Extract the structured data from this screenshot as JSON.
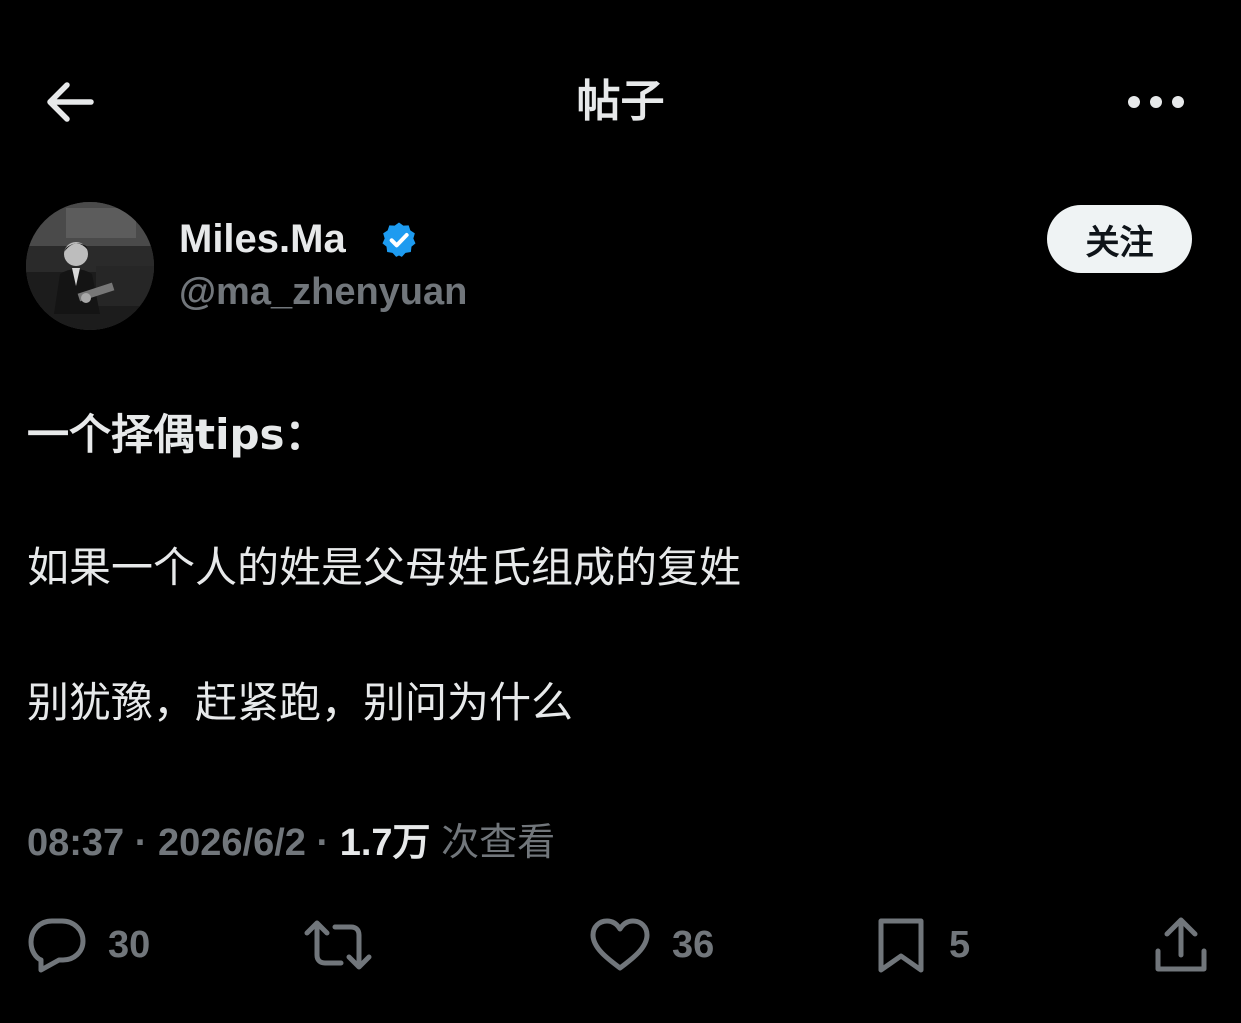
{
  "header": {
    "title": "帖子",
    "back_icon": "arrow-left-icon",
    "more_icon": "more-horizontal-icon"
  },
  "author": {
    "display_name": "Miles.Ma",
    "handle": "@ma_zhenyuan",
    "verified": true,
    "verified_color": "#1d9bf0",
    "follow_label": "关注"
  },
  "post": {
    "lines": [
      "一个择偶tips：",
      "如果一个人的姓是父母姓氏组成的复姓",
      "别犹豫，赶紧跑，别问为什么"
    ]
  },
  "meta": {
    "time": "08:37",
    "sep1": " · ",
    "date": "2026/6/2",
    "sep2": " · ",
    "views_count": "1.7万",
    "views_label": " 次查看"
  },
  "actions": {
    "reply_count": "30",
    "retweet_count": "",
    "like_count": "36",
    "bookmark_count": "5"
  },
  "colors": {
    "background": "#000000",
    "text": "#e7e9ea",
    "secondary": "#71767b",
    "follow_bg": "#eff3f4"
  }
}
